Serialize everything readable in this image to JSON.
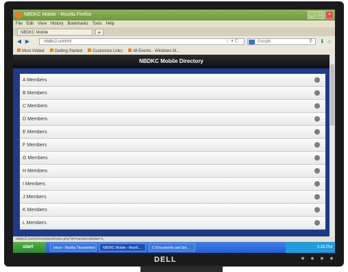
{
  "window": {
    "title": "NBDKC Mobile - Mozilla Firefox"
  },
  "menu": [
    "File",
    "Edit",
    "View",
    "History",
    "Bookmarks",
    "Tools",
    "Help"
  ],
  "tab": {
    "label": "NBDKC Mobile",
    "new_tab": "+"
  },
  "nav": {
    "url": "nbdkc2.com/m/",
    "search_placeholder": "Google"
  },
  "bookmarks": [
    "Most Visited",
    "Getting Started",
    "Customize Links",
    "All Events - Windows M..."
  ],
  "page": {
    "header": "NBDKC Mobile Directory",
    "rows": [
      "A Members",
      "B Members",
      "C Members",
      "D Members",
      "E Members",
      "F Members",
      "G Members",
      "H Members",
      "I Members",
      "J Members",
      "K Members",
      "L Members"
    ]
  },
  "status_text": "nbdkc2.com/m/members/index.php?id=members&letter=L",
  "taskbar": {
    "start": "start",
    "tasks": [
      "Inbox - Mozilla Thunderbird",
      "NBDKC Mobile - Mozill...",
      "C:\\Documents and Set..."
    ],
    "clock": "3:28 PM"
  },
  "monitor_brand": "DELL"
}
